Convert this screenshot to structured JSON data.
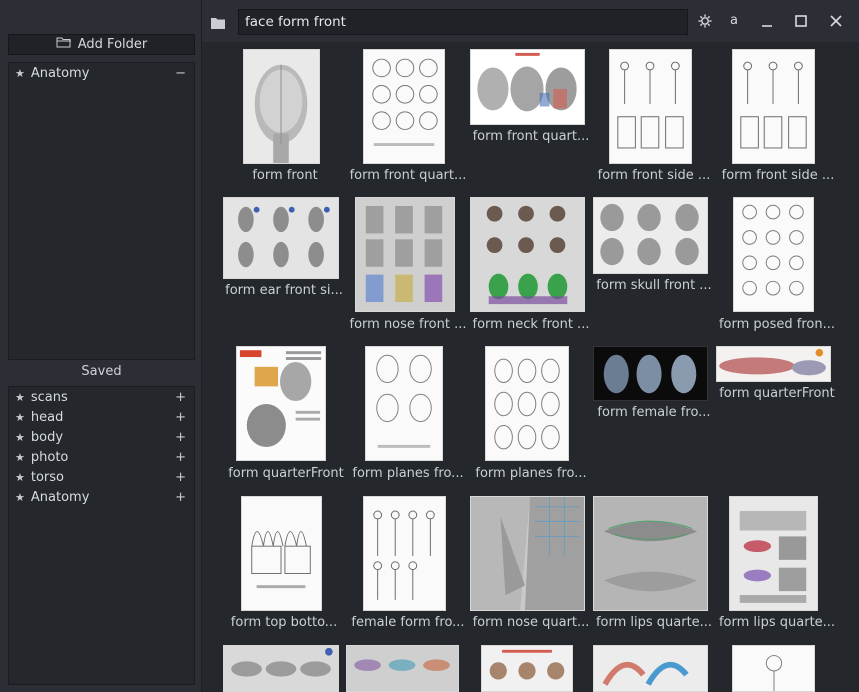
{
  "sidebar": {
    "add_folder_label": "Add Folder",
    "folders": [
      {
        "label": "Anatomy",
        "action": "−"
      }
    ],
    "saved_title": "Saved",
    "saved": [
      {
        "label": "scans",
        "action": "+"
      },
      {
        "label": "head",
        "action": "+"
      },
      {
        "label": "body",
        "action": "+"
      },
      {
        "label": "photo",
        "action": "+"
      },
      {
        "label": "torso",
        "action": "+"
      },
      {
        "label": "Anatomy",
        "action": "+"
      }
    ]
  },
  "toolbar": {
    "search_value": "face form front",
    "letter_button": "a"
  },
  "results": [
    {
      "caption": "form front"
    },
    {
      "caption": "form front quart..."
    },
    {
      "caption": "form front quart..."
    },
    {
      "caption": "form front side ..."
    },
    {
      "caption": "form front side ..."
    },
    {
      "caption": "form ear front si..."
    },
    {
      "caption": "form nose front ..."
    },
    {
      "caption": "form neck front ..."
    },
    {
      "caption": "form skull front ..."
    },
    {
      "caption": "form posed fron..."
    },
    {
      "caption": "form quarterFront"
    },
    {
      "caption": "form planes fro..."
    },
    {
      "caption": "form planes fro..."
    },
    {
      "caption": "form female fro..."
    },
    {
      "caption": "form quarterFront"
    },
    {
      "caption": "form top botto..."
    },
    {
      "caption": "female form fro..."
    },
    {
      "caption": "form nose quart..."
    },
    {
      "caption": "form lips quarte..."
    },
    {
      "caption": "form lips quarte..."
    },
    {
      "caption": ""
    },
    {
      "caption": ""
    },
    {
      "caption": ""
    },
    {
      "caption": ""
    },
    {
      "caption": ""
    }
  ]
}
